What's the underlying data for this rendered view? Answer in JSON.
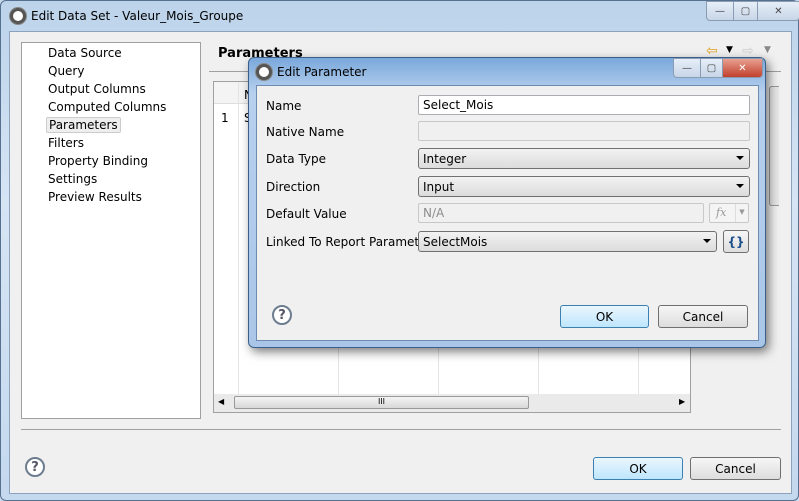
{
  "window": {
    "title": "Edit Data Set - Valeur_Mois_Groupe",
    "min": "—",
    "max": "▢",
    "close": "✕"
  },
  "nav": {
    "items": [
      "Data Source",
      "Query",
      "Output Columns",
      "Computed Columns",
      "Parameters",
      "Filters",
      "Property Binding",
      "Settings",
      "Preview Results"
    ],
    "selected": "Parameters"
  },
  "main": {
    "heading": "Parameters",
    "table": {
      "header_partial": "N",
      "row_num": "1",
      "row_partial": "S"
    },
    "scroll_thumb": "III"
  },
  "footer": {
    "ok": "OK",
    "cancel": "Cancel",
    "help": "?"
  },
  "dialog": {
    "title": "Edit Parameter",
    "fields": {
      "name": {
        "label": "Name",
        "value": "Select_Mois"
      },
      "native": {
        "label": "Native Name",
        "value": ""
      },
      "type": {
        "label": "Data Type",
        "value": "Integer"
      },
      "direction": {
        "label": "Direction",
        "value": "Input"
      },
      "default": {
        "label": "Default Value",
        "value": "N/A",
        "fx": "fx"
      },
      "linked": {
        "label": "Linked To Report Parameter",
        "value": "SelectMois",
        "expr": "{}"
      }
    },
    "ok": "OK",
    "cancel": "Cancel",
    "help": "?"
  }
}
